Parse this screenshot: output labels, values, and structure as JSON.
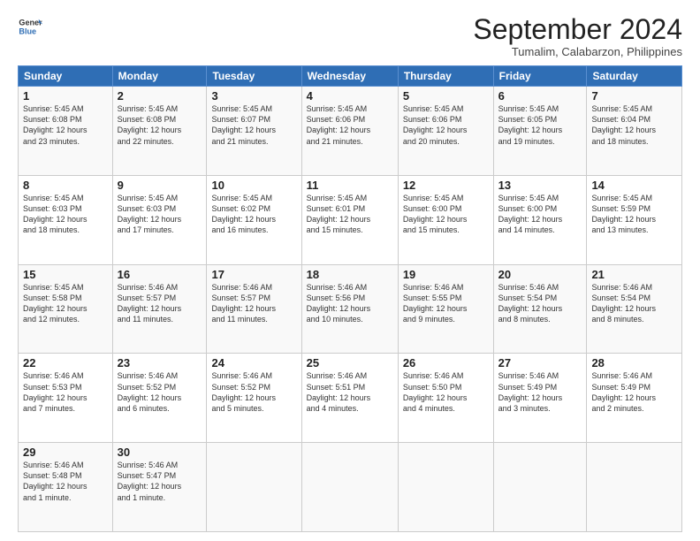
{
  "header": {
    "logo_line1": "General",
    "logo_line2": "Blue",
    "month": "September 2024",
    "location": "Tumalim, Calabarzon, Philippines"
  },
  "weekdays": [
    "Sunday",
    "Monday",
    "Tuesday",
    "Wednesday",
    "Thursday",
    "Friday",
    "Saturday"
  ],
  "weeks": [
    [
      {
        "day": "1",
        "info": "Sunrise: 5:45 AM\nSunset: 6:08 PM\nDaylight: 12 hours\nand 23 minutes."
      },
      {
        "day": "2",
        "info": "Sunrise: 5:45 AM\nSunset: 6:08 PM\nDaylight: 12 hours\nand 22 minutes."
      },
      {
        "day": "3",
        "info": "Sunrise: 5:45 AM\nSunset: 6:07 PM\nDaylight: 12 hours\nand 21 minutes."
      },
      {
        "day": "4",
        "info": "Sunrise: 5:45 AM\nSunset: 6:06 PM\nDaylight: 12 hours\nand 21 minutes."
      },
      {
        "day": "5",
        "info": "Sunrise: 5:45 AM\nSunset: 6:06 PM\nDaylight: 12 hours\nand 20 minutes."
      },
      {
        "day": "6",
        "info": "Sunrise: 5:45 AM\nSunset: 6:05 PM\nDaylight: 12 hours\nand 19 minutes."
      },
      {
        "day": "7",
        "info": "Sunrise: 5:45 AM\nSunset: 6:04 PM\nDaylight: 12 hours\nand 18 minutes."
      }
    ],
    [
      {
        "day": "8",
        "info": "Sunrise: 5:45 AM\nSunset: 6:03 PM\nDaylight: 12 hours\nand 18 minutes."
      },
      {
        "day": "9",
        "info": "Sunrise: 5:45 AM\nSunset: 6:03 PM\nDaylight: 12 hours\nand 17 minutes."
      },
      {
        "day": "10",
        "info": "Sunrise: 5:45 AM\nSunset: 6:02 PM\nDaylight: 12 hours\nand 16 minutes."
      },
      {
        "day": "11",
        "info": "Sunrise: 5:45 AM\nSunset: 6:01 PM\nDaylight: 12 hours\nand 15 minutes."
      },
      {
        "day": "12",
        "info": "Sunrise: 5:45 AM\nSunset: 6:00 PM\nDaylight: 12 hours\nand 15 minutes."
      },
      {
        "day": "13",
        "info": "Sunrise: 5:45 AM\nSunset: 6:00 PM\nDaylight: 12 hours\nand 14 minutes."
      },
      {
        "day": "14",
        "info": "Sunrise: 5:45 AM\nSunset: 5:59 PM\nDaylight: 12 hours\nand 13 minutes."
      }
    ],
    [
      {
        "day": "15",
        "info": "Sunrise: 5:45 AM\nSunset: 5:58 PM\nDaylight: 12 hours\nand 12 minutes."
      },
      {
        "day": "16",
        "info": "Sunrise: 5:46 AM\nSunset: 5:57 PM\nDaylight: 12 hours\nand 11 minutes."
      },
      {
        "day": "17",
        "info": "Sunrise: 5:46 AM\nSunset: 5:57 PM\nDaylight: 12 hours\nand 11 minutes."
      },
      {
        "day": "18",
        "info": "Sunrise: 5:46 AM\nSunset: 5:56 PM\nDaylight: 12 hours\nand 10 minutes."
      },
      {
        "day": "19",
        "info": "Sunrise: 5:46 AM\nSunset: 5:55 PM\nDaylight: 12 hours\nand 9 minutes."
      },
      {
        "day": "20",
        "info": "Sunrise: 5:46 AM\nSunset: 5:54 PM\nDaylight: 12 hours\nand 8 minutes."
      },
      {
        "day": "21",
        "info": "Sunrise: 5:46 AM\nSunset: 5:54 PM\nDaylight: 12 hours\nand 8 minutes."
      }
    ],
    [
      {
        "day": "22",
        "info": "Sunrise: 5:46 AM\nSunset: 5:53 PM\nDaylight: 12 hours\nand 7 minutes."
      },
      {
        "day": "23",
        "info": "Sunrise: 5:46 AM\nSunset: 5:52 PM\nDaylight: 12 hours\nand 6 minutes."
      },
      {
        "day": "24",
        "info": "Sunrise: 5:46 AM\nSunset: 5:52 PM\nDaylight: 12 hours\nand 5 minutes."
      },
      {
        "day": "25",
        "info": "Sunrise: 5:46 AM\nSunset: 5:51 PM\nDaylight: 12 hours\nand 4 minutes."
      },
      {
        "day": "26",
        "info": "Sunrise: 5:46 AM\nSunset: 5:50 PM\nDaylight: 12 hours\nand 4 minutes."
      },
      {
        "day": "27",
        "info": "Sunrise: 5:46 AM\nSunset: 5:49 PM\nDaylight: 12 hours\nand 3 minutes."
      },
      {
        "day": "28",
        "info": "Sunrise: 5:46 AM\nSunset: 5:49 PM\nDaylight: 12 hours\nand 2 minutes."
      }
    ],
    [
      {
        "day": "29",
        "info": "Sunrise: 5:46 AM\nSunset: 5:48 PM\nDaylight: 12 hours\nand 1 minute."
      },
      {
        "day": "30",
        "info": "Sunrise: 5:46 AM\nSunset: 5:47 PM\nDaylight: 12 hours\nand 1 minute."
      },
      {
        "day": "",
        "info": ""
      },
      {
        "day": "",
        "info": ""
      },
      {
        "day": "",
        "info": ""
      },
      {
        "day": "",
        "info": ""
      },
      {
        "day": "",
        "info": ""
      }
    ]
  ]
}
